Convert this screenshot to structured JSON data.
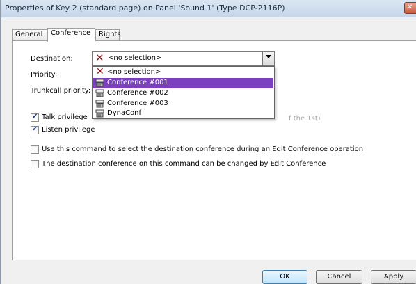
{
  "window": {
    "title": "Properties of Key 2 (standard page) on Panel 'Sound 1' (Type DCP-2116P)"
  },
  "tabs": [
    {
      "label": "General",
      "active": false
    },
    {
      "label": "Conference",
      "active": true
    },
    {
      "label": "Rights",
      "active": false
    }
  ],
  "form": {
    "destination_label": "Destination:",
    "priority_label": "Priority:",
    "trunkcall_label": "Trunkcall priority:",
    "destination_value": "<no selection>",
    "dropdown_options": [
      {
        "label": "<no selection>",
        "icon": "x-icon",
        "selected": false
      },
      {
        "label": "Conference #001",
        "icon": "conference-icon",
        "selected": true
      },
      {
        "label": "Conference #002",
        "icon": "conference-icon",
        "selected": false
      },
      {
        "label": "Conference #003",
        "icon": "conference-icon",
        "selected": false
      },
      {
        "label": "DynaConf",
        "icon": "conference-icon",
        "selected": false
      }
    ],
    "talk_privilege_label": "Talk privilege",
    "talk_privilege_checked": true,
    "listen_privilege_label": "Listen privilege",
    "listen_privilege_checked": true,
    "hidden_option_fragment": "f the 1st)",
    "use_command_label": "Use this command to select the destination conference during an Edit Conference operation",
    "use_command_checked": false,
    "can_change_label": "The destination conference on this command can be changed by Edit Conference",
    "can_change_checked": false
  },
  "buttons": {
    "ok": "OK",
    "cancel": "Cancel",
    "apply": "Apply"
  },
  "colors": {
    "selection": "#7b3fbf",
    "x_icon": "#8a0f0f"
  }
}
